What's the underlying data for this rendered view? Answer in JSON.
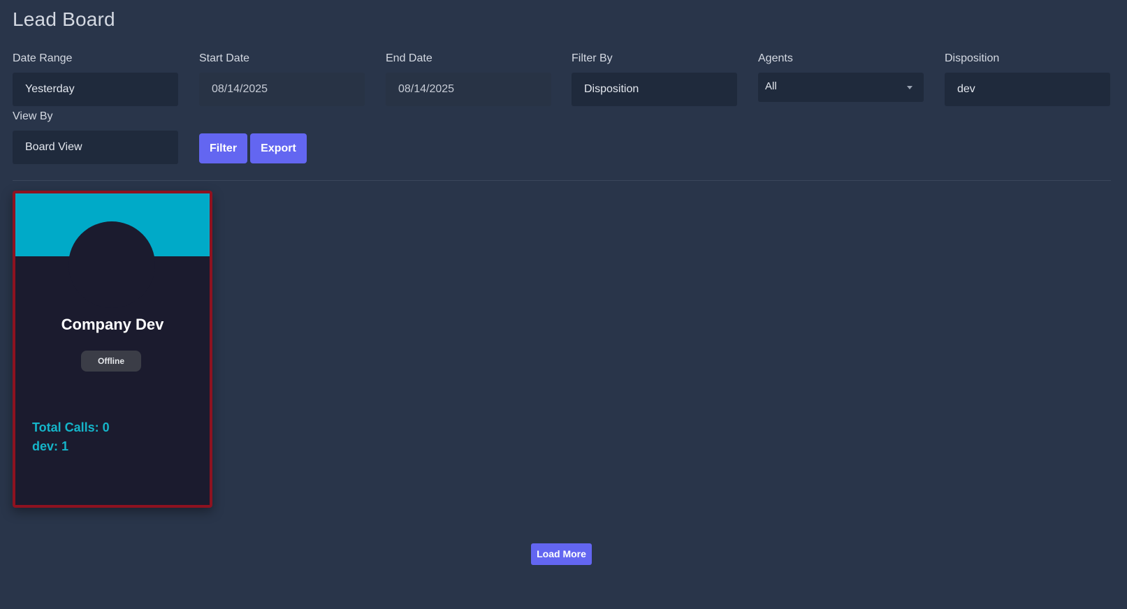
{
  "page": {
    "title": "Lead Board"
  },
  "filters": {
    "date_range": {
      "label": "Date Range",
      "value": "Yesterday"
    },
    "start_date": {
      "label": "Start Date",
      "value": "08/14/2025"
    },
    "end_date": {
      "label": "End Date",
      "value": "08/14/2025"
    },
    "filter_by": {
      "label": "Filter By",
      "value": "Disposition"
    },
    "agents": {
      "label": "Agents",
      "value": "All"
    },
    "disposition": {
      "label": "Disposition",
      "value": "dev"
    },
    "view_by": {
      "label": "View By",
      "value": "Board View"
    }
  },
  "actions": {
    "filter_label": "Filter",
    "export_label": "Export",
    "load_more_label": "Load More"
  },
  "cards": [
    {
      "name": "Company Dev",
      "status": "Offline",
      "total_calls": "Total Calls: 0",
      "disposition_count": "dev: 1"
    }
  ],
  "colors": {
    "background": "#29354a",
    "accent": "#6366f1",
    "banner": "#00aac8",
    "card_border": "#8e1220",
    "stat_text": "#15b5c9"
  }
}
